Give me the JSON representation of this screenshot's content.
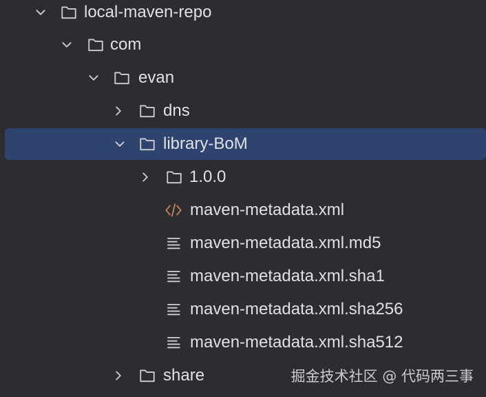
{
  "tree": {
    "items": [
      {
        "label": "local-maven-repo",
        "type": "folder",
        "expanded": true,
        "selected": false
      },
      {
        "label": "com",
        "type": "folder",
        "expanded": true,
        "selected": false
      },
      {
        "label": "evan",
        "type": "folder",
        "expanded": true,
        "selected": false
      },
      {
        "label": "dns",
        "type": "folder",
        "expanded": false,
        "selected": false
      },
      {
        "label": "library-BoM",
        "type": "folder",
        "expanded": true,
        "selected": true
      },
      {
        "label": "1.0.0",
        "type": "folder",
        "expanded": false,
        "selected": false
      },
      {
        "label": "maven-metadata.xml",
        "type": "xml-file",
        "selected": false
      },
      {
        "label": "maven-metadata.xml.md5",
        "type": "text-file",
        "selected": false
      },
      {
        "label": "maven-metadata.xml.sha1",
        "type": "text-file",
        "selected": false
      },
      {
        "label": "maven-metadata.xml.sha256",
        "type": "text-file",
        "selected": false
      },
      {
        "label": "maven-metadata.xml.sha512",
        "type": "text-file",
        "selected": false
      },
      {
        "label": "share",
        "type": "folder",
        "expanded": false,
        "selected": false
      }
    ]
  },
  "icons": {
    "folder": "folder-icon",
    "xml-file": "xml-file-icon",
    "text-file": "text-file-icon",
    "expanded": "chevron-down-icon",
    "collapsed": "chevron-right-icon"
  },
  "colors": {
    "background": "#2b2d30",
    "selection": "#2e436e",
    "text": "#dfe1e5",
    "icon": "#ced0d6",
    "xml_icon": "#c77d55"
  },
  "watermark": {
    "text": "掘金技术社区 @ 代码两三事"
  }
}
